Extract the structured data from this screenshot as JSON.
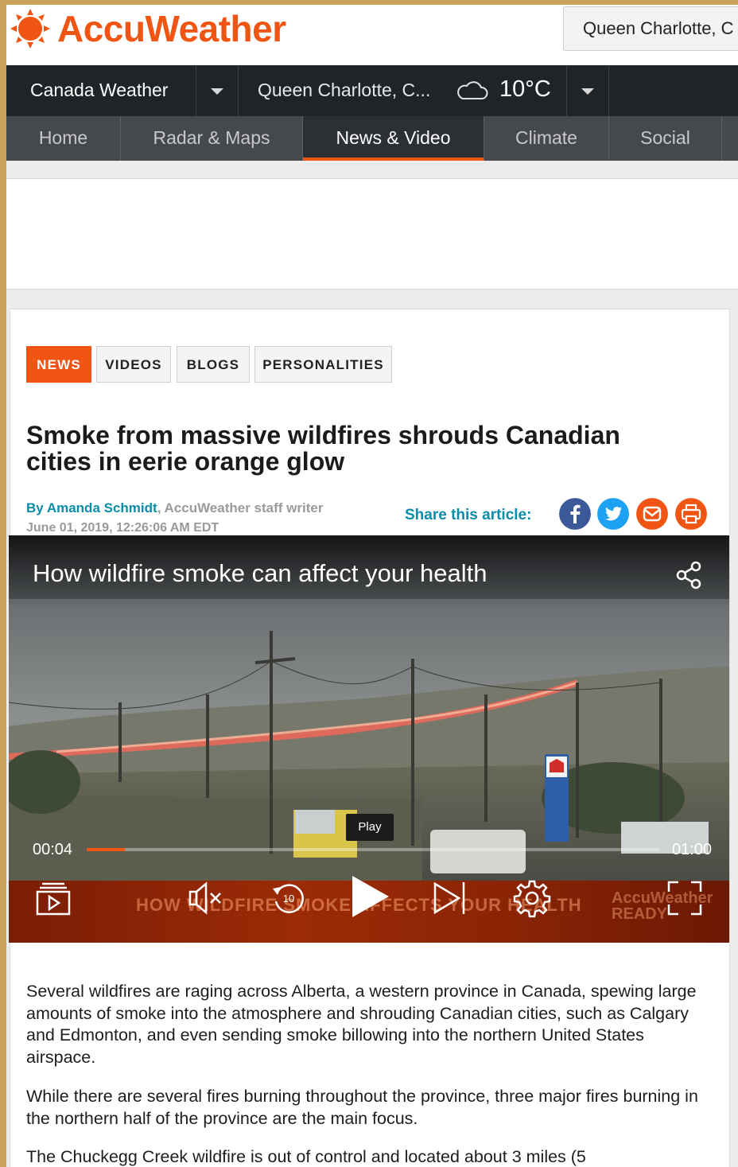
{
  "brand": {
    "name": "AccuWeather",
    "accent": "#f05514"
  },
  "header": {
    "location_search_value": "Queen Charlotte, C"
  },
  "navbar": {
    "region": "Canada Weather",
    "location": "Queen Charlotte, C...",
    "temperature": "10°C",
    "condition_icon": "cloud-icon"
  },
  "subnav": [
    {
      "label": "Home",
      "active": false
    },
    {
      "label": "Radar & Maps",
      "active": false
    },
    {
      "label": "News & Video",
      "active": true
    },
    {
      "label": "Climate",
      "active": false
    },
    {
      "label": "Social",
      "active": false
    }
  ],
  "tags": [
    "NEWS",
    "VIDEOS",
    "BLOGS",
    "PERSONALITIES"
  ],
  "article": {
    "title": "Smoke from massive wildfires shrouds Canadian cities in eerie orange glow",
    "author": "By Amanda Schmidt",
    "author_role": ", AccuWeather staff writer",
    "date": "June 01, 2019, 12:26:06 AM EDT",
    "share_label": "Share this article:",
    "share_icons": [
      {
        "name": "facebook-icon",
        "color": "#3b5998"
      },
      {
        "name": "twitter-icon",
        "color": "#1da1f2"
      },
      {
        "name": "email-icon",
        "color": "#f05514"
      },
      {
        "name": "print-icon",
        "color": "#f05514"
      }
    ],
    "paragraphs": [
      "Several wildfires are raging across Alberta, a western province in Canada, spewing large amounts of smoke into the atmosphere and shrouding Canadian cities, such as Calgary and Edmonton, and even sending smoke billowing into the northern United States airspace.",
      "While there are several fires burning throughout the province, three major fires burning in the northern half of the province are the main focus.",
      "The Chuckegg Creek wildfire is out of control and located about 3 miles (5"
    ]
  },
  "video": {
    "title": "How wildfire smoke can affect your health",
    "tooltip": "Play",
    "current_time": "00:04",
    "duration": "01:00",
    "progress": 0.067,
    "band_text": "HOW WILDFIRE SMOKE AFFECTS YOUR HEALTH",
    "band_brand_line1": "AccuWeather",
    "band_brand_line2": "READY",
    "rewind_seconds": "10"
  }
}
